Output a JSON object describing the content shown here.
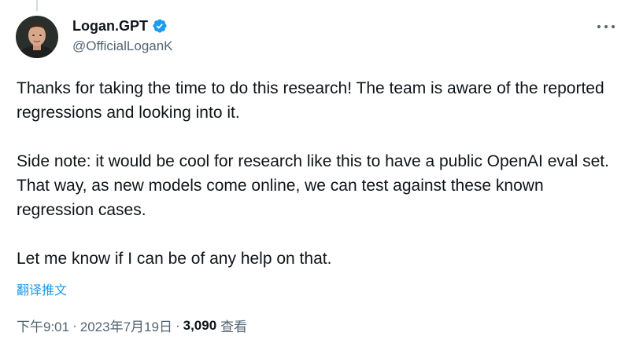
{
  "author": {
    "display_name": "Logan.GPT",
    "handle": "@OfficialLoganK",
    "verified": true,
    "avatar_icon": "profile-photo"
  },
  "tweet": {
    "paragraphs": [
      "Thanks for taking the time to do this research! The team is aware of the reported regressions and looking into it.",
      "Side note: it would be cool for research like this to have a public OpenAI eval set. That way, as new models come online, we can test against these known regression cases.",
      "Let me know if I can be of any help on that."
    ],
    "translate_label": "翻译推文"
  },
  "meta": {
    "time": "下午9:01",
    "separator": "·",
    "date": "2023年7月19日",
    "views_count": "3,090",
    "views_label": "查看"
  },
  "colors": {
    "text": "#0f1419",
    "secondary": "#536471",
    "accent": "#1d9bf0"
  }
}
